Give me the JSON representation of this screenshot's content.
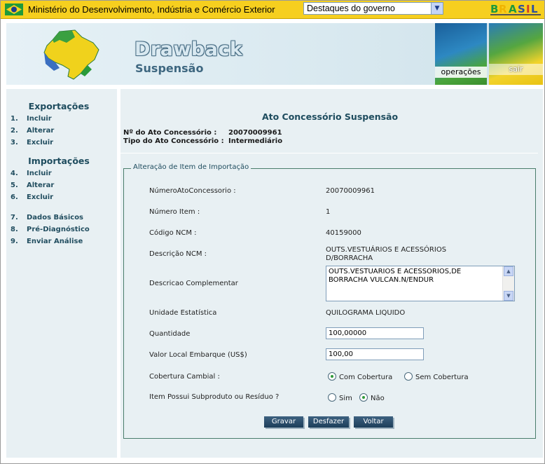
{
  "govbar": {
    "title": "Ministério do Desenvolvimento, Indústria e Comércio Exterior",
    "select_value": "Destaques do governo",
    "brand_color": "#f6cf1f"
  },
  "banner": {
    "title": "Drawback",
    "subtitle": "Suspensão",
    "operacoes_label": "operações",
    "sair_label": "sair"
  },
  "sidebar": {
    "export_title": "Exportações",
    "export_items": [
      {
        "num": "1.",
        "label": "Incluir"
      },
      {
        "num": "2.",
        "label": "Alterar"
      },
      {
        "num": "3.",
        "label": "Excluir"
      }
    ],
    "import_title": "Importações",
    "import_items": [
      {
        "num": "4.",
        "label": "Incluir"
      },
      {
        "num": "5.",
        "label": "Alterar"
      },
      {
        "num": "6.",
        "label": "Excluir"
      }
    ],
    "other_items": [
      {
        "num": "7.",
        "label": "Dados Básicos"
      },
      {
        "num": "8.",
        "label": "Pré-Diagnóstico"
      },
      {
        "num": "9.",
        "label": "Enviar Análise"
      }
    ]
  },
  "main": {
    "page_title": "Ato Concessório Suspensão",
    "ato_label": "Nº do Ato Concessório :",
    "ato_value": "20070009961",
    "tipo_label": "Tipo do Ato Concessório :",
    "tipo_value": "Intermediário",
    "form": {
      "legend": "Alteração de Item de Importação",
      "numero_ato_label": "NúmeroAtoConcessorio :",
      "numero_ato_value": "20070009961",
      "numero_item_label": "Número Item :",
      "numero_item_value": "1",
      "codigo_ncm_label": "Código NCM :",
      "codigo_ncm_value": "40159000",
      "descricao_ncm_label": "Descrição NCM :",
      "descricao_ncm_line1": "OUTS.VESTUÁRIOS E ACESSÓRIOS",
      "descricao_ncm_line2": "D/BORRACHA",
      "descricao_comp_label": "Descricao Complementar",
      "descricao_comp_line1": "OUTS.VESTUARIOS E ACESSORIOS,DE",
      "descricao_comp_line2": "BORRACHA VULCAN.N/ENDUR",
      "unidade_label": "Unidade Estatística",
      "unidade_value": "QUILOGRAMA LIQUIDO",
      "quantidade_label": "Quantidade",
      "quantidade_value": "100,00000",
      "valor_label": "Valor Local Embarque (US$)",
      "valor_value": "100,00",
      "cobertura_label": "Cobertura Cambial :",
      "cobertura_options": [
        "Com Cobertura",
        "Sem Cobertura"
      ],
      "cobertura_selected": "Com Cobertura",
      "subproduto_label": "Item Possui Subproduto ou Resíduo ?",
      "subproduto_options": [
        "Sim",
        "Não"
      ],
      "subproduto_selected": "Não",
      "buttons": {
        "gravar": "Gravar",
        "desfazer": "Desfazer",
        "voltar": "Voltar"
      }
    }
  }
}
